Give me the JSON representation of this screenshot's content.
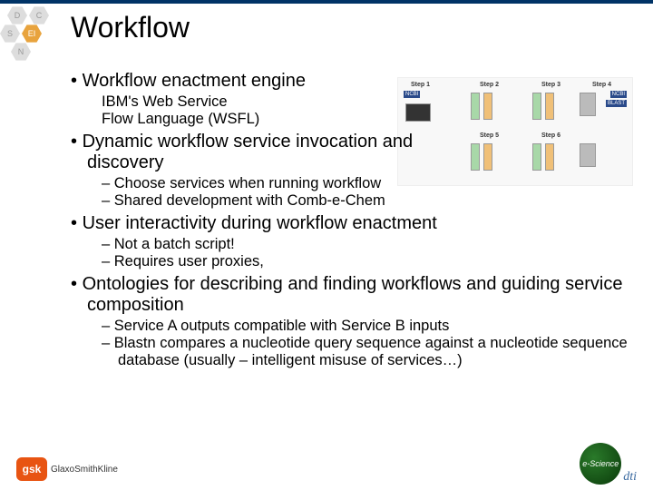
{
  "title": "Workflow",
  "bullets": {
    "b1": "Workflow enactment engine",
    "s1a": "IBM's Web Service",
    "s1b": "Flow Language (WSFL)",
    "b2": "Dynamic workflow service invocation and discovery",
    "s2a": "Choose services when running workflow",
    "s2b": "Shared development with Comb-e-Chem",
    "b3": "User interactivity during workflow enactment",
    "s3a": "Not a batch script!",
    "s3b": "Requires user proxies,",
    "b4": "Ontologies for describing and finding workflows and guiding service composition",
    "s4a": "Service A  outputs compatible with Service B inputs",
    "s4b": "Blastn compares a nucleotide query sequence against a nucleotide sequence database (usually – intelligent misuse of services…)"
  },
  "diagram": {
    "step1": "Step 1",
    "step2": "Step 2",
    "step3": "Step 3",
    "step4": "Step 4",
    "step5": "Step 5",
    "step6": "Step 6",
    "ncbi": "NCBI",
    "blast": "BLAST"
  },
  "footer": {
    "gsk": "gsk",
    "gsk_text": "GlaxoSmithKline",
    "esci": "e-Science",
    "dti": "dti"
  }
}
